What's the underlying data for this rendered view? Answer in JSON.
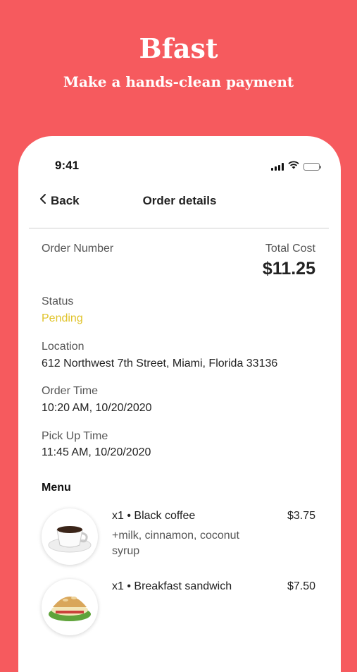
{
  "promo": {
    "title": "Bfast",
    "subtitle": "Make a hands-clean payment"
  },
  "status_bar": {
    "time": "9:41"
  },
  "nav": {
    "back_label": "Back",
    "title": "Order details"
  },
  "order": {
    "number_label": "Order Number",
    "total_label": "Total Cost",
    "total_value": "$11.25",
    "status_label": "Status",
    "status_value": "Pending",
    "location_label": "Location",
    "location_value": "612 Northwest 7th Street, Miami, Florida 33136",
    "order_time_label": "Order Time",
    "order_time_value": "10:20 AM, 10/20/2020",
    "pickup_time_label": "Pick Up Time",
    "pickup_time_value": "11:45 AM, 10/20/2020"
  },
  "menu": {
    "heading": "Menu",
    "items": [
      {
        "title": "x1 • Black coffee",
        "description": "+milk, cinnamon, coconut syrup",
        "price": "$3.75",
        "image": "coffee-cup"
      },
      {
        "title": "x1 • Breakfast sandwich",
        "description": "",
        "price": "$7.50",
        "image": "sandwich"
      }
    ]
  },
  "colors": {
    "background": "#f65a5e",
    "status_pending": "#e0c32a"
  }
}
